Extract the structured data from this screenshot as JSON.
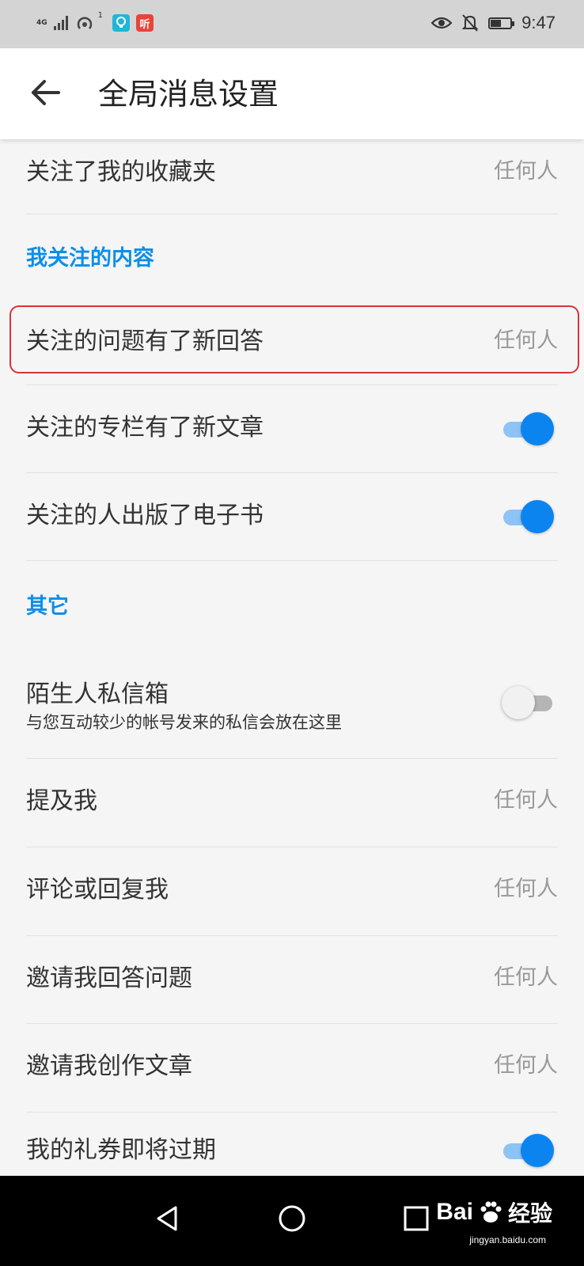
{
  "status_bar": {
    "network": "4G",
    "hotspot_count": "1",
    "app_icons": [
      "lightbulb-app-icon",
      "listen-app-icon"
    ],
    "listen_icon_text": "听",
    "time": "9:47",
    "battery_level": 0.5
  },
  "header": {
    "title": "全局消息设置"
  },
  "rows": {
    "favorites_followed": {
      "label": "关注了我的收藏夹",
      "value": "任何人"
    },
    "followed_question_answered": {
      "label": "关注的问题有了新回答",
      "value": "任何人"
    },
    "followed_column_article": {
      "label": "关注的专栏有了新文章",
      "toggle": true
    },
    "followed_person_ebook": {
      "label": "关注的人出版了电子书",
      "toggle": true
    },
    "stranger_inbox": {
      "label": "陌生人私信箱",
      "description": "与您互动较少的帐号发来的私信会放在这里",
      "toggle": false
    },
    "mention_me": {
      "label": "提及我",
      "value": "任何人"
    },
    "comment_reply": {
      "label": "评论或回复我",
      "value": "任何人"
    },
    "invite_answer": {
      "label": "邀请我回答问题",
      "value": "任何人"
    },
    "invite_article": {
      "label": "邀请我创作文章",
      "value": "任何人"
    },
    "coupon_expiring": {
      "label": "我的礼券即将过期",
      "toggle": true
    }
  },
  "sections": {
    "my_follows": "我关注的内容",
    "other": "其它"
  },
  "colors": {
    "accent": "#0b84f0",
    "section_title": "#0d8ee9",
    "highlight_box": "#d8323c"
  },
  "watermark": {
    "brand": "Bai",
    "brand_tail": "经验",
    "url": "jingyan.baidu.com"
  }
}
